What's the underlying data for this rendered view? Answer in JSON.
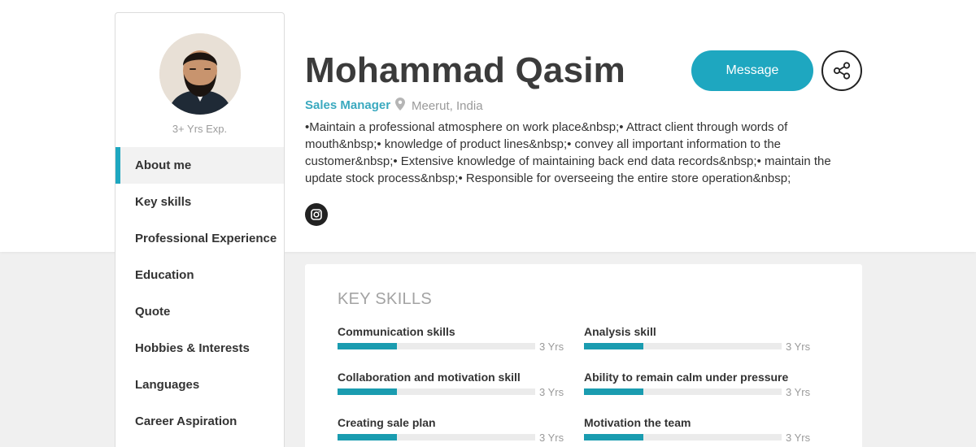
{
  "profile": {
    "name": "Mohammad Qasim",
    "role": "Sales Manager",
    "location": "Meerut, India",
    "experience": "3+ Yrs Exp.",
    "description": "•Maintain a professional atmosphere on work place&nbsp;• Attract client through words of mouth&nbsp;• knowledge of product lines&nbsp;• convey all important information to the customer&nbsp;• Extensive knowledge of maintaining back end data records&nbsp;• maintain the update stock process&nbsp;• Responsible for overseeing the entire store operation&nbsp;"
  },
  "actions": {
    "message_label": "Message"
  },
  "sidebar": {
    "items": [
      {
        "label": "About me",
        "active": true
      },
      {
        "label": "Key skills"
      },
      {
        "label": "Professional Experience"
      },
      {
        "label": "Education"
      },
      {
        "label": "Quote"
      },
      {
        "label": "Hobbies & Interests"
      },
      {
        "label": "Languages"
      },
      {
        "label": "Career Aspiration"
      }
    ]
  },
  "skills": {
    "title": "KEY SKILLS",
    "items": [
      {
        "name": "Communication skills",
        "years": "3 Yrs",
        "level": 0.3
      },
      {
        "name": "Analysis skill",
        "years": "3 Yrs",
        "level": 0.3
      },
      {
        "name": "Collaboration and motivation skill",
        "years": "3 Yrs",
        "level": 0.3
      },
      {
        "name": "Ability to remain calm under pressure",
        "years": "3 Yrs",
        "level": 0.3
      },
      {
        "name": "Creating sale plan",
        "years": "3 Yrs",
        "level": 0.3
      },
      {
        "name": "Motivation the team",
        "years": "3 Yrs",
        "level": 0.3
      }
    ]
  },
  "colors": {
    "accent": "#1ea7c0",
    "bar_fill": "#1a9cb0"
  }
}
